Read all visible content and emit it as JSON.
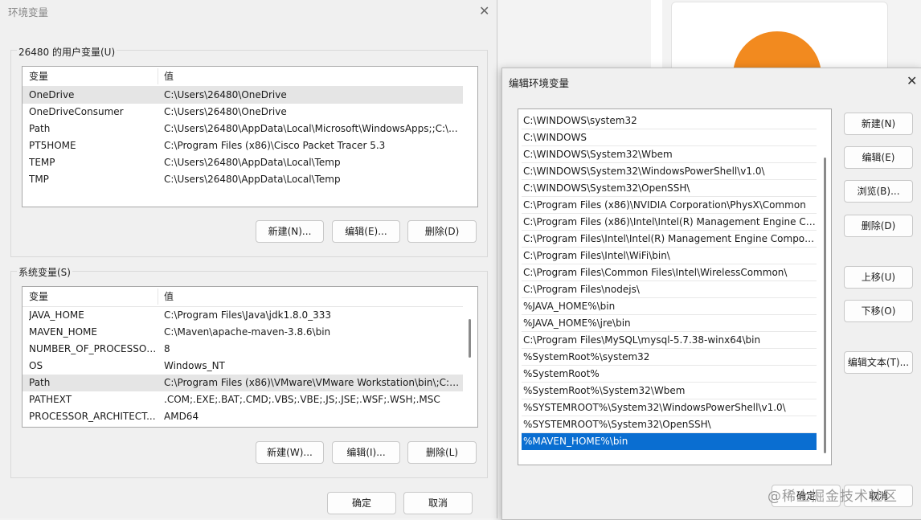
{
  "background": {
    "accent_color": "#f28a1f"
  },
  "env_dialog": {
    "title": "环境变量",
    "close_icon": "close-icon",
    "user_vars": {
      "group_label": "26480 的用户变量(U)",
      "columns": [
        "变量",
        "值"
      ],
      "rows": [
        {
          "name": "OneDrive",
          "value": "C:\\Users\\26480\\OneDrive"
        },
        {
          "name": "OneDriveConsumer",
          "value": "C:\\Users\\26480\\OneDrive"
        },
        {
          "name": "Path",
          "value": "C:\\Users\\26480\\AppData\\Local\\Microsoft\\WindowsApps;;C:\\..."
        },
        {
          "name": "PT5HOME",
          "value": "C:\\Program Files (x86)\\Cisco Packet Tracer 5.3"
        },
        {
          "name": "TEMP",
          "value": "C:\\Users\\26480\\AppData\\Local\\Temp"
        },
        {
          "name": "TMP",
          "value": "C:\\Users\\26480\\AppData\\Local\\Temp"
        }
      ],
      "selected_row": 0,
      "buttons": {
        "new": "新建(N)...",
        "edit": "编辑(E)...",
        "delete": "删除(D)"
      }
    },
    "system_vars": {
      "group_label": "系统变量(S)",
      "columns": [
        "变量",
        "值"
      ],
      "rows": [
        {
          "name": "JAVA_HOME",
          "value": "C:\\Program Files\\Java\\jdk1.8.0_333"
        },
        {
          "name": "MAVEN_HOME",
          "value": "C:\\Maven\\apache-maven-3.8.6\\bin"
        },
        {
          "name": "NUMBER_OF_PROCESSORS",
          "value": "8"
        },
        {
          "name": "OS",
          "value": "Windows_NT"
        },
        {
          "name": "Path",
          "value": "C:\\Program Files (x86)\\VMware\\VMware Workstation\\bin\\;C:\\..."
        },
        {
          "name": "PATHEXT",
          "value": ".COM;.EXE;.BAT;.CMD;.VBS;.VBE;.JS;.JSE;.WSF;.WSH;.MSC"
        },
        {
          "name": "PROCESSOR_ARCHITECT...",
          "value": "AMD64"
        }
      ],
      "selected_row": 4,
      "buttons": {
        "new": "新建(W)...",
        "edit": "编辑(I)...",
        "delete": "删除(L)"
      }
    },
    "ok_label": "确定",
    "cancel_label": "取消"
  },
  "edit_dialog": {
    "title": "编辑环境变量",
    "close_icon": "close-icon",
    "paths": [
      "C:\\WINDOWS\\system32",
      "C:\\WINDOWS",
      "C:\\WINDOWS\\System32\\Wbem",
      "C:\\WINDOWS\\System32\\WindowsPowerShell\\v1.0\\",
      "C:\\WINDOWS\\System32\\OpenSSH\\",
      "C:\\Program Files (x86)\\NVIDIA Corporation\\PhysX\\Common",
      "C:\\Program Files (x86)\\Intel\\Intel(R) Management Engine Co...",
      "C:\\Program Files\\Intel\\Intel(R) Management Engine Compon...",
      "C:\\Program Files\\Intel\\WiFi\\bin\\",
      "C:\\Program Files\\Common Files\\Intel\\WirelessCommon\\",
      "C:\\Program Files\\nodejs\\",
      "%JAVA_HOME%\\bin",
      "%JAVA_HOME%\\jre\\bin",
      "C:\\Program Files\\MySQL\\mysql-5.7.38-winx64\\bin",
      "%SystemRoot%\\system32",
      "%SystemRoot%",
      "%SystemRoot%\\System32\\Wbem",
      "%SYSTEMROOT%\\System32\\WindowsPowerShell\\v1.0\\",
      "%SYSTEMROOT%\\System32\\OpenSSH\\",
      "%MAVEN_HOME%\\bin"
    ],
    "selected_index": 19,
    "selection_color": "#0a6ed1",
    "buttons": {
      "new": "新建(N)",
      "edit": "编辑(E)",
      "browse": "浏览(B)...",
      "delete": "删除(D)",
      "move_up": "上移(U)",
      "move_down": "下移(O)",
      "edit_text": "编辑文本(T)..."
    },
    "ok_label": "确定",
    "cancel_label": "取消"
  },
  "watermark": "@稀土掘金技术社区"
}
